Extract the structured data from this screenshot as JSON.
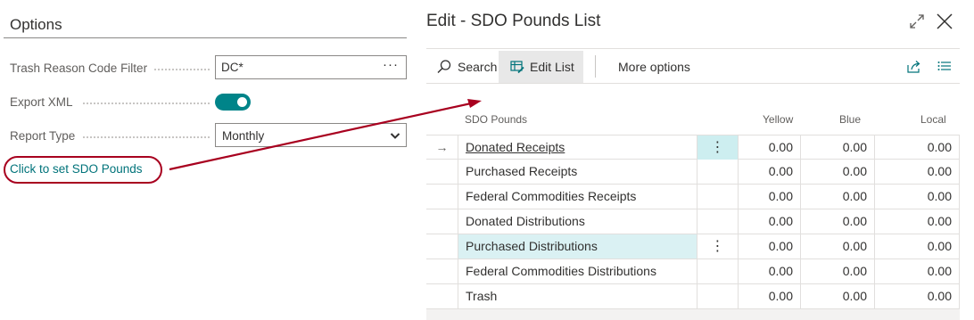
{
  "options": {
    "title": "Options",
    "trash_filter_label": "Trash Reason Code Filter",
    "trash_filter_value": "DC*",
    "export_xml_label": "Export XML",
    "export_xml_on": true,
    "report_type_label": "Report Type",
    "report_type_value": "Monthly",
    "sdo_link": "Click to set SDO Pounds"
  },
  "page": {
    "title": "Edit - SDO Pounds List"
  },
  "toolbar": {
    "search_label": "Search",
    "edit_list_label": "Edit List",
    "more_options_label": "More options"
  },
  "columns": {
    "name": "SDO Pounds",
    "yellow": "Yellow",
    "blue": "Blue",
    "local": "Local"
  },
  "rows": [
    {
      "name": "Donated Receipts",
      "yellow": "0.00",
      "blue": "0.00",
      "local": "0.00"
    },
    {
      "name": "Purchased Receipts",
      "yellow": "0.00",
      "blue": "0.00",
      "local": "0.00"
    },
    {
      "name": "Federal Commodities Receipts",
      "yellow": "0.00",
      "blue": "0.00",
      "local": "0.00"
    },
    {
      "name": "Donated Distributions",
      "yellow": "0.00",
      "blue": "0.00",
      "local": "0.00"
    },
    {
      "name": "Purchased Distributions",
      "yellow": "0.00",
      "blue": "0.00",
      "local": "0.00"
    },
    {
      "name": "Federal Commodities Distributions",
      "yellow": "0.00",
      "blue": "0.00",
      "local": "0.00"
    },
    {
      "name": "Trash",
      "yellow": "0.00",
      "blue": "0.00",
      "local": "0.00"
    }
  ],
  "colors": {
    "accent": "#008489",
    "link": "#00737a",
    "annotation": "#a8001f",
    "row_highlight": "#cdeef0"
  }
}
